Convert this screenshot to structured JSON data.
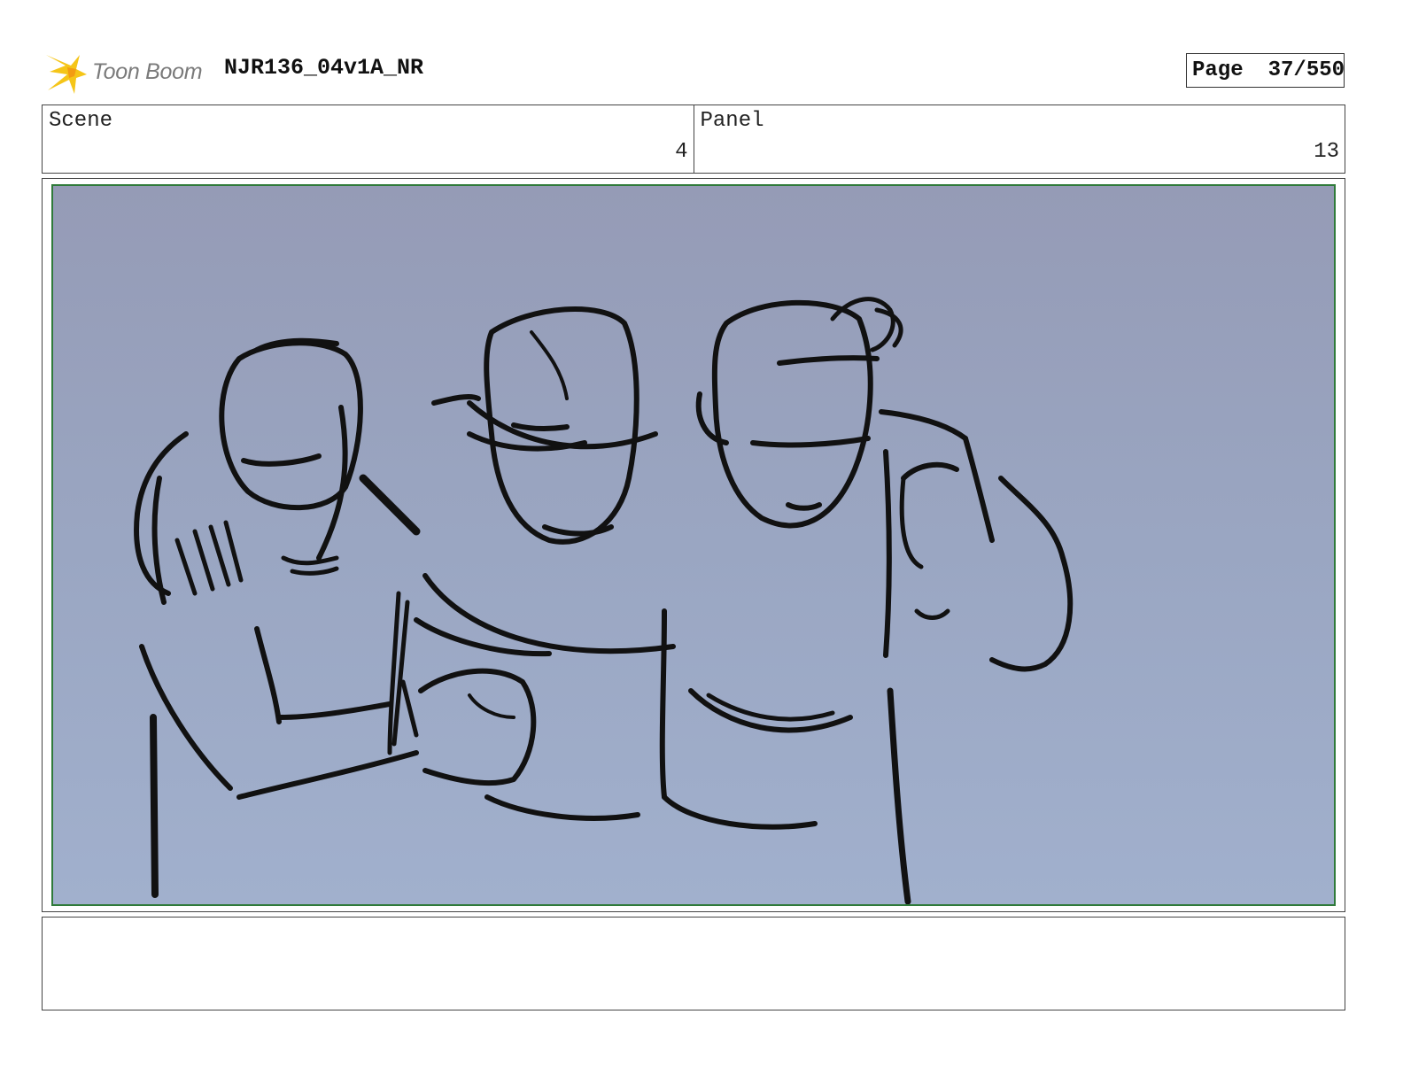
{
  "header": {
    "logo_text": "Toon Boom",
    "project_title": "NJR136_04v1A_NR",
    "page_label": "Page",
    "page_number": "37/550"
  },
  "scene": {
    "label": "Scene",
    "value": "4"
  },
  "panel": {
    "label": "Panel",
    "value": "13"
  },
  "notes": {
    "text": ""
  },
  "colors": {
    "frame_border": "#2f7a3a",
    "background_top": "#959bb6",
    "background_bottom": "#a1b0cd",
    "logo_accent": "#f5c518"
  }
}
